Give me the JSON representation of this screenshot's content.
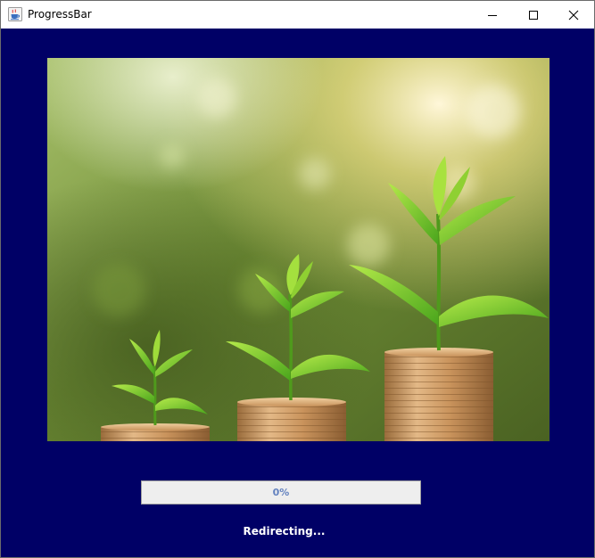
{
  "window": {
    "title": "ProgressBar",
    "icon": "java-cup-icon",
    "controls": [
      "minimize-icon",
      "maximize-icon",
      "close-icon"
    ],
    "background_color": "#000066"
  },
  "image": {
    "subject": "plant-sprouts-on-coin-stacks-photo"
  },
  "progress": {
    "value": 0,
    "label": "0%",
    "track_color": "#eeeeee",
    "accent_color": "#6382bf"
  },
  "status": {
    "text": "Redirecting..."
  }
}
